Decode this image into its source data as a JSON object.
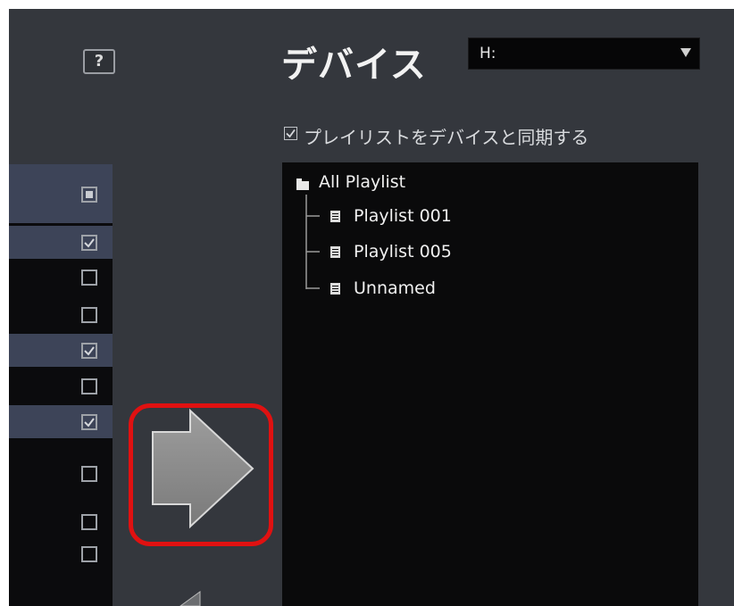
{
  "header": {
    "title": "デバイス",
    "help_label": "?",
    "drive_select": {
      "value": "H:"
    }
  },
  "sync_option": {
    "label": "プレイリストをデバイスと同期する",
    "checked": true
  },
  "left_list": {
    "header_checkbox": "mixed",
    "rows": [
      {
        "selected": true,
        "checked": true
      },
      {
        "selected": false,
        "checked": false
      },
      {
        "selected": false,
        "checked": false
      },
      {
        "selected": true,
        "checked": true
      },
      {
        "selected": false,
        "checked": false
      },
      {
        "selected": true,
        "checked": true
      },
      {
        "selected": false,
        "checked": false
      },
      {
        "selected": false,
        "checked": false
      },
      {
        "selected": false,
        "checked": false
      }
    ]
  },
  "tree": {
    "root": {
      "label": "All Playlist",
      "icon": "folder-icon"
    },
    "children": [
      {
        "label": "Playlist 001",
        "icon": "playlist-icon"
      },
      {
        "label": "Playlist 005",
        "icon": "playlist-icon"
      },
      {
        "label": "Unnamed",
        "icon": "playlist-icon"
      }
    ]
  },
  "transfer_button": {
    "icon": "right-arrow-icon",
    "highlight_color": "#e01111"
  },
  "colors": {
    "background": "#34373d",
    "panel": "#0a0a0b",
    "selected_row": "#3d4458"
  }
}
